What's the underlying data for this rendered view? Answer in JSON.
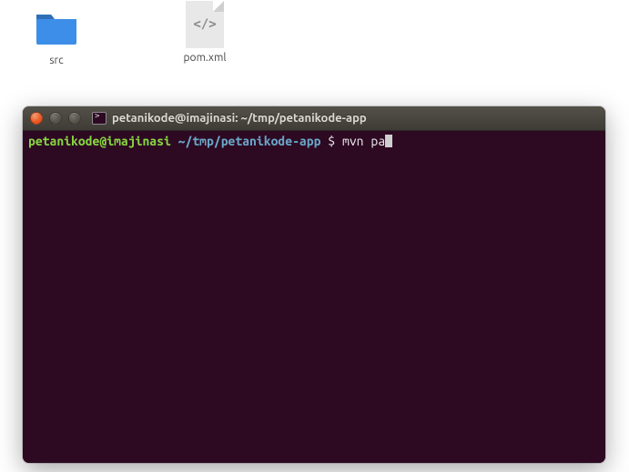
{
  "desktop": {
    "folder": {
      "name": "src"
    },
    "xml_file": {
      "name": "pom.xml",
      "badge": "</>"
    }
  },
  "terminal": {
    "title": "petanikode@imajinasi: ~/tmp/petanikode-app",
    "prompt": {
      "user_host": "petanikode@imajinasi",
      "path": "~/tmp/petanikode-app",
      "separator": " $ "
    },
    "command": "mvn pa"
  },
  "colors": {
    "terminal_bg": "#2d0922",
    "prompt_user": "#87d441",
    "prompt_path": "#6aa6c8",
    "accent_close": "#e95420",
    "folder_blue": "#3d8ee8"
  }
}
